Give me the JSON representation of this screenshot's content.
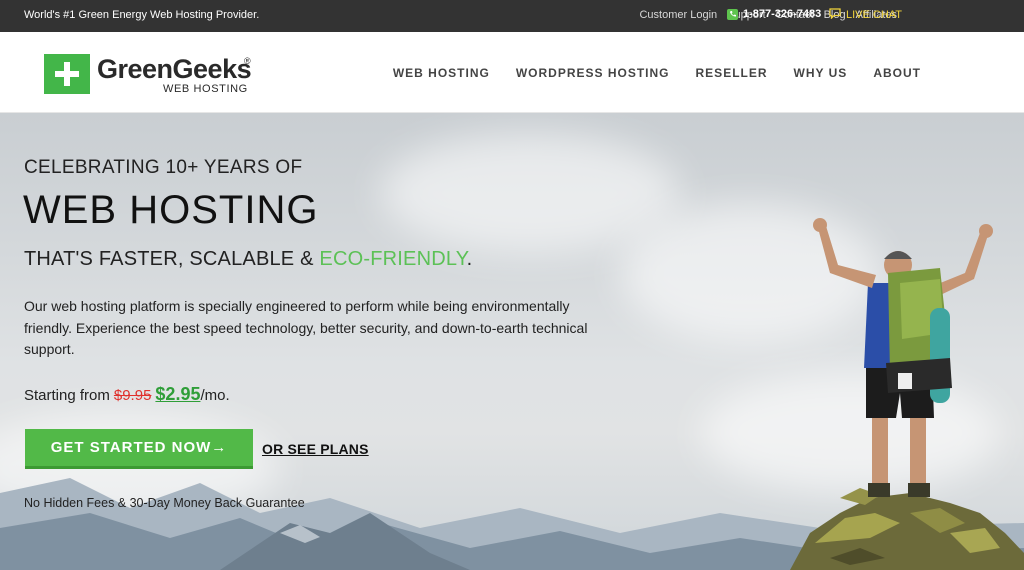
{
  "topbar": {
    "tagline": "World's #1 Green Energy Web Hosting Provider.",
    "links": [
      "Customer Login",
      "Support",
      "Contact",
      "Blog",
      "Affiliates"
    ],
    "phone": "1-877-326-7483",
    "chat": "LIVE CHAT",
    "phone_icon": "phone-icon",
    "chat_icon": "chat-icon"
  },
  "header": {
    "logo_name": "GreenGeeks",
    "logo_reg": "®",
    "logo_sub": "WEB HOSTING",
    "nav": [
      "WEB HOSTING",
      "WORDPRESS HOSTING",
      "RESELLER",
      "WHY US",
      "ABOUT"
    ]
  },
  "hero": {
    "kicker": "CELEBRATING 10+ YEARS OF",
    "title": "WEB HOSTING",
    "sub_prefix": "THAT'S FASTER, SCALABLE & ",
    "sub_eco": "ECO-FRIENDLY",
    "sub_suffix": ".",
    "body": "Our web hosting platform is specially engineered to perform while being environmentally friendly. Experience the best speed technology, better security, and down-to-earth technical support.",
    "price_prefix": "Starting from",
    "price_old": "$9.95",
    "price_new": "$2.95",
    "price_suffix": "/mo.",
    "cta": "GET STARTED NOW→",
    "plans_link": "OR SEE PLANS",
    "guarantee": "No Hidden Fees & 30-Day Money Back Guarantee"
  },
  "colors": {
    "brand_green": "#43b649",
    "eco_green": "#5cc156",
    "topbar_bg": "#333333",
    "chat_yellow": "#f2d43c",
    "old_price_red": "#e0312d"
  }
}
